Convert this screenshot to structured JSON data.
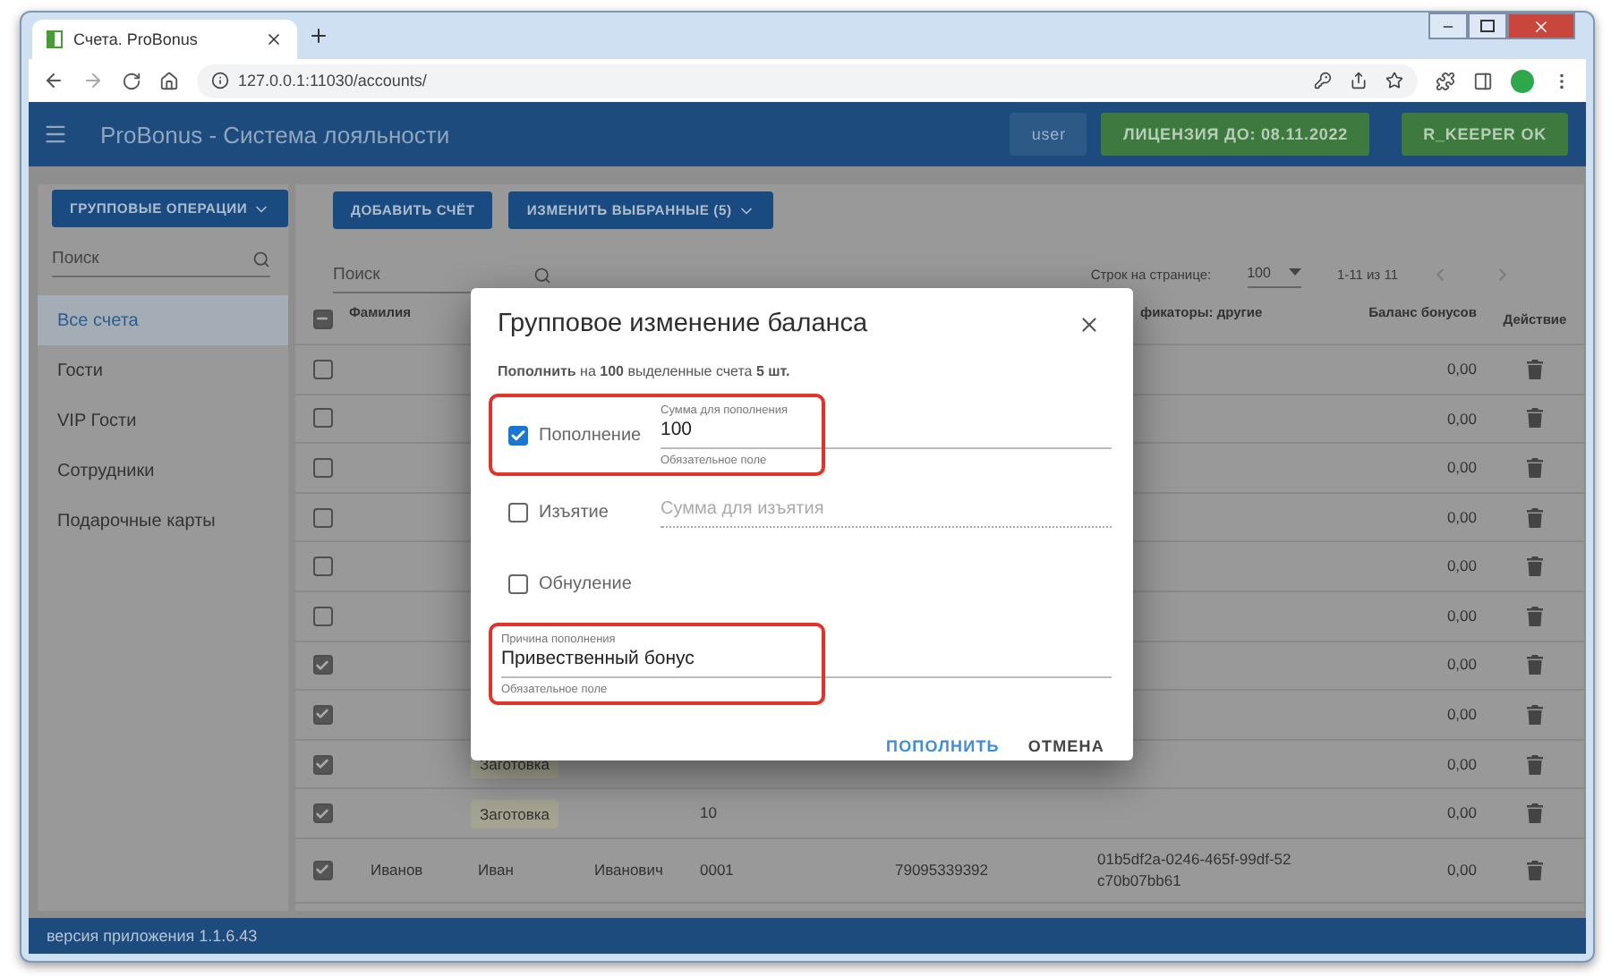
{
  "browser": {
    "tab": {
      "title": "Счета. ProBonus",
      "selected": true
    },
    "url": "127.0.0.1:11030/accounts/"
  },
  "app": {
    "title": "ProBonus - Система лояльности",
    "user": "user",
    "license": "ЛИЦЕНЗИЯ ДО: 08.11.2022",
    "status": "R_KEEPER OK"
  },
  "sidebar": {
    "group_button": "ГРУППОВЫЕ ОПЕРАЦИИ",
    "search_placeholder": "Поиск",
    "items": [
      {
        "label": "Все счета",
        "selected": true
      },
      {
        "label": "Гости",
        "selected": false
      },
      {
        "label": "VIP Гости",
        "selected": false
      },
      {
        "label": "Сотрудники",
        "selected": false
      },
      {
        "label": "Подарочные карты",
        "selected": false
      }
    ]
  },
  "toolbar": {
    "buttons": [
      {
        "label": "ДОБАВИТЬ СЧЁТ",
        "dropdown": false
      },
      {
        "label": "ИЗМЕНИТЬ ВЫБРАННЫЕ (5)",
        "dropdown": true
      }
    ],
    "search_placeholder": "Поиск"
  },
  "pagination": {
    "rows_label": "Строк на странице:",
    "rows_value": "100",
    "range": "1-11 из 11",
    "prev_disabled": true,
    "next_disabled": true
  },
  "table": {
    "select_all_partial": true,
    "columns": [
      {
        "kind": "surname",
        "label": "Фамилия"
      },
      {
        "kind": "identifiers",
        "label": "фикаторы: другие"
      },
      {
        "kind": "balance",
        "label": "Баланс бонусов"
      },
      {
        "kind": "action",
        "label": "Действие"
      }
    ],
    "rows": [
      {
        "checked": false,
        "balance": "0,00"
      },
      {
        "checked": false,
        "balance": "0,00"
      },
      {
        "checked": false,
        "balance": "0,00"
      },
      {
        "checked": false,
        "balance": "0,00"
      },
      {
        "checked": false,
        "balance": "0,00"
      },
      {
        "checked": false,
        "balance": "0,00"
      },
      {
        "checked": true,
        "balance": "0,00"
      },
      {
        "checked": true,
        "balance": "0,00"
      },
      {
        "checked": true,
        "tag": "Заготовка",
        "balance": "0,00"
      },
      {
        "checked": true,
        "tag": "Заготовка",
        "number": "10",
        "balance": "0,00"
      },
      {
        "checked": true,
        "surname": "Иванов",
        "name": "Иван",
        "patronymic": "Иванович",
        "number": "0001",
        "phone": "79095339392",
        "identifier": "01b5df2a-0246-465f-99df-52c70b07bb61",
        "balance": "0,00"
      }
    ]
  },
  "dialog": {
    "title": "Групповое изменение баланса",
    "summary": "**Пополнить** на **100** выделенные счета **5 шт.**",
    "options": [
      {
        "kind": "checkbox-field",
        "label": "Пополнение",
        "checked": true,
        "highlighted": true,
        "field": {
          "label": "Сумма для пополнения",
          "value": "100",
          "helper": "Обязательное поле",
          "disabled": false
        }
      },
      {
        "kind": "checkbox-field",
        "label": "Изъятие",
        "checked": false,
        "highlighted": false,
        "field": {
          "placeholder": "Сумма для изъятия",
          "disabled": true
        }
      },
      {
        "kind": "checkbox",
        "label": "Обнуление",
        "checked": false,
        "highlighted": false
      }
    ],
    "reason": {
      "label": "Причина пополнения",
      "value": "Привественный бонус",
      "helper": "Обязательное поле",
      "highlighted": true
    },
    "buttons": [
      {
        "label": "ПОПОЛНИТЬ",
        "primary": true
      },
      {
        "label": "ОТМЕНА",
        "primary": false
      }
    ]
  },
  "footer": {
    "version": "версия приложения 1.1.6.43"
  }
}
